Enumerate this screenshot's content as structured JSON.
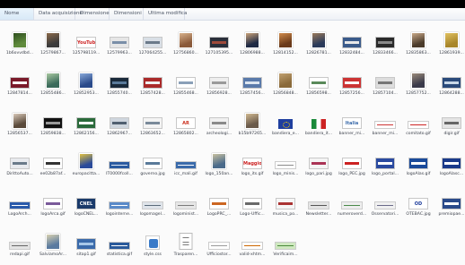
{
  "columns": [
    {
      "id": "nome",
      "label": "Nome"
    },
    {
      "id": "data",
      "label": "Data acquisizione"
    },
    {
      "id": "dim",
      "label": "Dimensione"
    },
    {
      "id": "dims",
      "label": "Dimensioni"
    },
    {
      "id": "mod",
      "label": "Ultima modifica"
    }
  ],
  "files": [
    {
      "label": "1b6ovvdbd...",
      "icon": "green-landscape-thumbnail",
      "kind": "photo",
      "c1": "#5f8a3c",
      "c2": "#2f4f1f"
    },
    {
      "label": "12579867...",
      "icon": "dark-photo-thumbnail",
      "kind": "photo",
      "c1": "#3b3b3b",
      "c2": "#8a6a4a"
    },
    {
      "label": "125798119...",
      "icon": "youtube-logo-thumbnail",
      "kind": "logo",
      "c1": "#ffffff",
      "c2": "#cc2222",
      "text": "YouTube"
    },
    {
      "label": "12579963...",
      "icon": "screenshot-thumbnail",
      "kind": "logo",
      "c1": "#e6e6e6",
      "c2": "#7a8fa8"
    },
    {
      "label": "127064255...",
      "icon": "gray-banner-thumbnail",
      "kind": "logo",
      "c1": "#d9dfe6",
      "c2": "#6b7a8a"
    },
    {
      "label": "12756860...",
      "icon": "news-photo-thumbnail",
      "kind": "photo",
      "c1": "#8a5a3a",
      "c2": "#d7b08a"
    },
    {
      "label": "127105395...",
      "icon": "dark-banner-thumbnail",
      "kind": "logo",
      "c1": "#2a2f3a",
      "c2": "#a04a3a"
    },
    {
      "label": "12806988...",
      "icon": "portrait-photo-thumbnail",
      "kind": "photo",
      "c1": "#1f2a44",
      "c2": "#c9a27a"
    },
    {
      "label": "12814152...",
      "icon": "brown-photo-thumbnail",
      "kind": "photo",
      "c1": "#6a3a1a",
      "c2": "#d08a4a"
    },
    {
      "label": "12826781...",
      "icon": "people-photo-thumbnail",
      "kind": "photo",
      "c1": "#2a3a5a",
      "c2": "#9a7a5a"
    },
    {
      "label": "12832484...",
      "icon": "blue-banner-thumbnail",
      "kind": "logo",
      "c1": "#3a5a8a",
      "c2": "#e8e8e8"
    },
    {
      "label": "12833466...",
      "icon": "dark-banner-thumbnail",
      "kind": "logo",
      "c1": "#2a2a2a",
      "c2": "#8a8a8a"
    },
    {
      "label": "12835863...",
      "icon": "portrait-photo-thumbnail",
      "kind": "photo",
      "c1": "#4a3a2a",
      "c2": "#c8a888"
    },
    {
      "label": "12861939...",
      "icon": "gold-photo-thumbnail",
      "kind": "photo",
      "c1": "#a8862a",
      "c2": "#e0c060"
    },
    {
      "label": "12847814...",
      "icon": "maroon-banner-thumbnail",
      "kind": "logo",
      "c1": "#7a1a2a",
      "c2": "#ffffff"
    },
    {
      "label": "12855486...",
      "icon": "teal-photo-thumbnail",
      "kind": "photo",
      "c1": "#3a6a5a",
      "c2": "#a8c8a0"
    },
    {
      "label": "12852953...",
      "icon": "blue-photo-thumbnail",
      "kind": "photo",
      "c1": "#2a4a8a",
      "c2": "#88a8d8"
    },
    {
      "label": "12855740...",
      "icon": "dark-photo-thumbnail",
      "kind": "logo",
      "c1": "#1a2a3a",
      "c2": "#5a7a9a"
    },
    {
      "label": "12857428...",
      "icon": "red-banner-thumbnail",
      "kind": "logo",
      "c1": "#aa2a2a",
      "c2": "#f0f0f0"
    },
    {
      "label": "12855468...",
      "icon": "white-banner-thumbnail",
      "kind": "logo",
      "c1": "#ffffff",
      "c2": "#8aa0b8"
    },
    {
      "label": "12856928...",
      "icon": "document-thumbnail",
      "kind": "logo",
      "c1": "#eeeeee",
      "c2": "#9a9a9a"
    },
    {
      "label": "12857456...",
      "icon": "blue-banner-thumbnail",
      "kind": "logo",
      "c1": "#5a7aaa",
      "c2": "#dde6f0"
    },
    {
      "label": "12856848...",
      "icon": "brown-photo-thumbnail",
      "kind": "photo",
      "c1": "#8a6a3a",
      "c2": "#c0a070"
    },
    {
      "label": "12856598...",
      "icon": "white-banner-thumbnail",
      "kind": "logo",
      "c1": "#ffffff",
      "c2": "#5a8a5a"
    },
    {
      "label": "12857256...",
      "icon": "red-banner-thumbnail",
      "kind": "logo",
      "c1": "#cc3333",
      "c2": "#ffffff"
    },
    {
      "label": "12857104...",
      "icon": "gray-banner-thumbnail",
      "kind": "logo",
      "c1": "#dddddd",
      "c2": "#777777"
    },
    {
      "label": "12857752...",
      "icon": "dark-photo-thumbnail",
      "kind": "photo",
      "c1": "#3a3a4a",
      "c2": "#9a8a7a"
    },
    {
      "label": "12864288...",
      "icon": "blue-banner-thumbnail",
      "kind": "logo",
      "c1": "#2a4a7a",
      "c2": "#c8d8e8"
    },
    {
      "label": "12856537...",
      "icon": "people-photo-thumbnail",
      "kind": "photo",
      "c1": "#5a4a3a",
      "c2": "#d8c8b8"
    },
    {
      "label": "12859838...",
      "icon": "dark-banner-thumbnail",
      "kind": "logo",
      "c1": "#111111",
      "c2": "#999999"
    },
    {
      "label": "12862156...",
      "icon": "green-banner-thumbnail",
      "kind": "logo",
      "c1": "#2a6a3a",
      "c2": "#ffffff"
    },
    {
      "label": "12862967...",
      "icon": "gray-banner-thumbnail",
      "kind": "logo",
      "c1": "#cfd6de",
      "c2": "#506070"
    },
    {
      "label": "12863652...",
      "icon": "white-banner-thumbnail",
      "kind": "logo",
      "c1": "#f4f4f4",
      "c2": "#7a8a9a"
    },
    {
      "label": "12865802...",
      "icon": "ar-logo-thumbnail",
      "kind": "logo",
      "c1": "#ffffff",
      "c2": "#cc3322",
      "text": "AR"
    },
    {
      "label": "archeologi...",
      "icon": "document-thumbnail",
      "kind": "logo",
      "c1": "#f0f0f0",
      "c2": "#8a8a8a"
    },
    {
      "label": "b15b97265...",
      "icon": "photo-thumbnail",
      "kind": "photo",
      "c1": "#6a5a4a",
      "c2": "#d0b890"
    },
    {
      "label": "bandiera_e...",
      "icon": "eu-flag-icon",
      "kind": "flag",
      "c1": "#1f3f9f",
      "c2": "#ffd500"
    },
    {
      "label": "bandiera_it...",
      "icon": "italian-flag-icon",
      "kind": "flag",
      "c1": "#1a8a3a",
      "c2": "#cc2222",
      "c3": "#ffffff"
    },
    {
      "label": "banner_mi...",
      "icon": "banner-thumbnail",
      "kind": "logo",
      "c1": "#ffffff",
      "c2": "#3a6aaa",
      "text": "Italia"
    },
    {
      "label": "banner_mi...",
      "icon": "banner-thumbnail",
      "kind": "wide",
      "c1": "#ffffff",
      "c2": "#cc3333"
    },
    {
      "label": "comitato.gif",
      "icon": "banner-thumbnail",
      "kind": "wide",
      "c1": "#ffffff",
      "c2": "#cc2222"
    },
    {
      "label": "digir.gif",
      "icon": "gray-banner-thumbnail",
      "kind": "logo",
      "c1": "#e4e4e4",
      "c2": "#666666"
    },
    {
      "label": "DirittoAuto...",
      "icon": "gray-banner-thumbnail",
      "kind": "logo",
      "c1": "#e8eaee",
      "c2": "#6a7a8a"
    },
    {
      "label": "ee02b87af...",
      "icon": "document-thumbnail",
      "kind": "logo",
      "c1": "#ffffff",
      "c2": "#333333"
    },
    {
      "label": "europacitta...",
      "icon": "eu-photo-thumbnail",
      "kind": "photo",
      "c1": "#2a4a9a",
      "c2": "#e0c040"
    },
    {
      "label": "IT0000fcoll...",
      "icon": "blue-banner-thumbnail",
      "kind": "wide",
      "c1": "#2a5aa0",
      "c2": "#dde8f4"
    },
    {
      "label": "governo.jpg",
      "icon": "banner-thumbnail",
      "kind": "logo",
      "c1": "#ffffff",
      "c2": "#5a7a9a"
    },
    {
      "label": "icc_mali.gif",
      "icon": "blue-banner-thumbnail",
      "kind": "wide",
      "c1": "#3a6aaa",
      "c2": "#ffffff"
    },
    {
      "label": "logo_150an...",
      "icon": "photo-thumbnail",
      "kind": "photo",
      "c1": "#4a6a8a",
      "c2": "#c8c0a0"
    },
    {
      "label": "logo_its.gif",
      "icon": "text-logo-thumbnail",
      "kind": "logo",
      "c1": "#ffffff",
      "c2": "#cc2222",
      "text": "Maggio"
    },
    {
      "label": "logo_minis...",
      "icon": "white-banner-thumbnail",
      "kind": "wide",
      "c1": "#ffffff",
      "c2": "#8a8a8a"
    },
    {
      "label": "logo_pari.jpg",
      "icon": "banner-thumbnail",
      "kind": "logo",
      "c1": "#f4f4f4",
      "c2": "#aa3355"
    },
    {
      "label": "logo_PEC.jpg",
      "icon": "red-logo-thumbnail",
      "kind": "logo",
      "c1": "#ffffff",
      "c2": "#cc2222"
    },
    {
      "label": "logo_portal...",
      "icon": "blue-logo-thumbnail",
      "kind": "logo",
      "c1": "#2a4aa0",
      "c2": "#ffffff"
    },
    {
      "label": "logoAlas.gif",
      "icon": "blue-logo-thumbnail",
      "kind": "logo",
      "c1": "#1a4a9a",
      "c2": "#ffffff"
    },
    {
      "label": "logoAlasc...",
      "icon": "blue-logo-thumbnail",
      "kind": "logo",
      "c1": "#1a3a8a",
      "c2": "#ffffff"
    },
    {
      "label": "LogoArch...",
      "icon": "blue-banner-thumbnail",
      "kind": "wide",
      "c1": "#2a5aaa",
      "c2": "#ffffff"
    },
    {
      "label": "logoArca.gif",
      "icon": "document-thumbnail",
      "kind": "logo",
      "c1": "#ffffff",
      "c2": "#7a5a9a"
    },
    {
      "label": "logoCNEL...",
      "icon": "dark-logo-thumbnail",
      "kind": "logo",
      "c1": "#1a3a6a",
      "c2": "#ffffff",
      "text": "CNEL"
    },
    {
      "label": "logointerne...",
      "icon": "blue-banner-thumbnail",
      "kind": "wide",
      "c1": "#5a8ac8",
      "c2": "#ffffff"
    },
    {
      "label": "logomagel...",
      "icon": "gray-banner-thumbnail",
      "kind": "wide",
      "c1": "#dfe4ea",
      "c2": "#5a6a7a"
    },
    {
      "label": "logominist...",
      "icon": "gray-banner-thumbnail",
      "kind": "wide",
      "c1": "#e6e6e6",
      "c2": "#7a7a7a"
    },
    {
      "label": "LogoPRC_...",
      "icon": "round-logo-thumbnail",
      "kind": "logo",
      "c1": "#ffffff",
      "c2": "#cc6622"
    },
    {
      "label": "Logo-Uffic...",
      "icon": "document-thumbnail",
      "kind": "logo",
      "c1": "#ffffff",
      "c2": "#6a6a6a"
    },
    {
      "label": "musica_po...",
      "icon": "document-thumbnail",
      "kind": "logo",
      "c1": "#f6f6f6",
      "c2": "#aa3333"
    },
    {
      "label": "Newsletter...",
      "icon": "gray-banner-thumbnail",
      "kind": "wide",
      "c1": "#e4e4e4",
      "c2": "#555555"
    },
    {
      "label": "numeroverd...",
      "icon": "gray-banner-thumbnail",
      "kind": "wide",
      "c1": "#eeeeee",
      "c2": "#4a8a4a"
    },
    {
      "label": "Osservatori...",
      "icon": "gray-banner-thumbnail",
      "kind": "wide",
      "c1": "#f0f0f0",
      "c2": "#6a6a8a"
    },
    {
      "label": "OTEBAC.jpg",
      "icon": "blue-logo-thumbnail",
      "kind": "logo",
      "c1": "#ffffff",
      "c2": "#1a3a9a",
      "text": "OD"
    },
    {
      "label": "premiopae...",
      "icon": "blue-logo-thumbnail",
      "kind": "logo",
      "c1": "#2a4a8a",
      "c2": "#ffffff"
    },
    {
      "label": "redapi.gif",
      "icon": "gray-banner-thumbnail",
      "kind": "wide",
      "c1": "#e4e4e4",
      "c2": "#666666"
    },
    {
      "label": "SalviamoAr...",
      "icon": "photo-thumbnail",
      "kind": "photo",
      "c1": "#5a7aa0",
      "c2": "#d8d0b0"
    },
    {
      "label": "sitap1.gif",
      "icon": "map-thumbnail",
      "kind": "logo",
      "c1": "#3a6aaa",
      "c2": "#a8c8e8"
    },
    {
      "label": "statistica.gif",
      "icon": "blue-banner-thumbnail",
      "kind": "wide",
      "c1": "#2a5a9a",
      "c2": "#ffffff"
    },
    {
      "label": "style.css",
      "icon": "css-file-icon",
      "kind": "icon",
      "c1": "#ffffff",
      "c2": "#3a7ac8"
    },
    {
      "label": "Trasparen...",
      "icon": "document-file-icon",
      "kind": "doc",
      "c1": "#ffffff",
      "c2": "#7a7a7a"
    },
    {
      "label": "Ufficiostor...",
      "icon": "white-banner-thumbnail",
      "kind": "wide",
      "c1": "#ffffff",
      "c2": "#9a9a9a"
    },
    {
      "label": "valid-xhtm...",
      "icon": "w3c-badge-thumbnail",
      "kind": "wide",
      "c1": "#ffffff",
      "c2": "#cc6600"
    },
    {
      "label": "Verificaim...",
      "icon": "green-banner-thumbnail",
      "kind": "wide",
      "c1": "#cfe8c0",
      "c2": "#4a8a3a"
    }
  ]
}
